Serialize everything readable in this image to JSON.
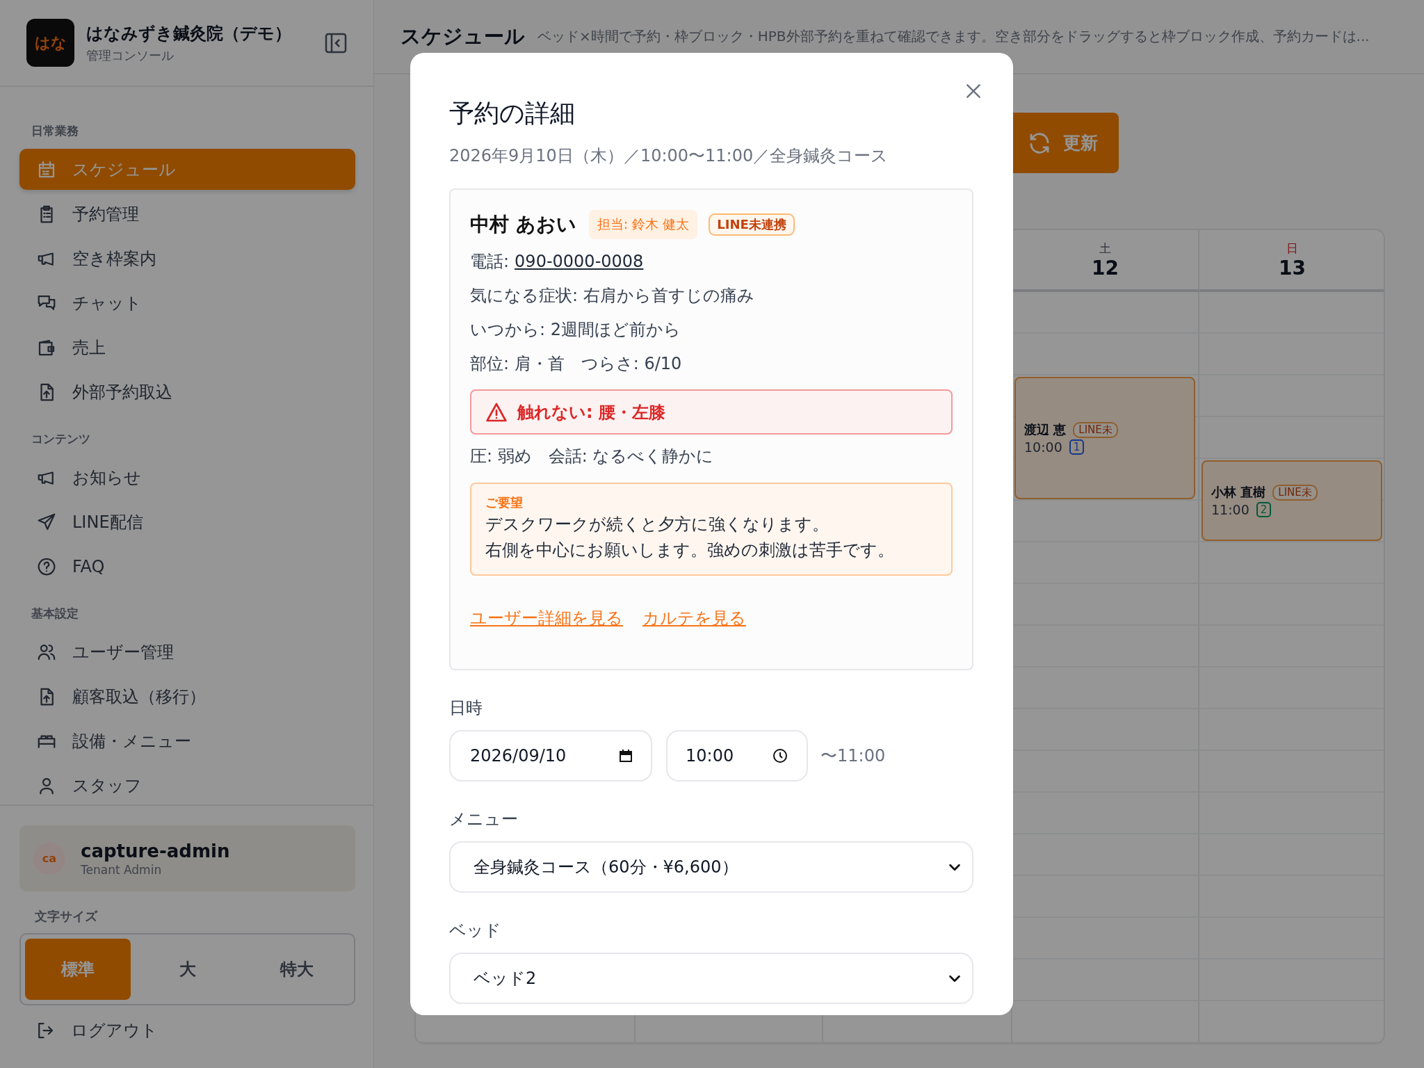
{
  "sidebar": {
    "logo": "はな",
    "title": "はなみずき鍼灸院（デモ）",
    "subtitle": "管理コンソール",
    "sections": [
      {
        "heading": "日常業務",
        "items": [
          {
            "label": "スケジュール",
            "selected": true
          },
          {
            "label": "予約管理",
            "selected": false
          },
          {
            "label": "空き枠案内",
            "selected": false
          },
          {
            "label": "チャット",
            "selected": false
          },
          {
            "label": "売上",
            "selected": false
          },
          {
            "label": "外部予約取込",
            "selected": false
          }
        ]
      },
      {
        "heading": "コンテンツ",
        "items": [
          {
            "label": "お知らせ",
            "selected": false
          },
          {
            "label": "LINE配信",
            "selected": false
          },
          {
            "label": "FAQ",
            "selected": false
          }
        ]
      },
      {
        "heading": "基本設定",
        "items": [
          {
            "label": "ユーザー管理",
            "selected": false
          },
          {
            "label": "顧客取込（移行）",
            "selected": false
          },
          {
            "label": "設備・メニュー",
            "selected": false
          },
          {
            "label": "スタッフ",
            "selected": false
          }
        ]
      }
    ],
    "user": {
      "initials": "ca",
      "name": "capture-admin",
      "role": "Tenant Admin"
    },
    "font_size": {
      "label": "文字サイズ",
      "options": [
        {
          "label": "標準",
          "selected": true
        },
        {
          "label": "大",
          "selected": false
        },
        {
          "label": "特大",
          "selected": false
        }
      ]
    },
    "logout": "ログアウト"
  },
  "header": {
    "title": "スケジュール",
    "description": "ベッド×時間で予約・枠ブロック・HPB外部予約を重ねて確認できます。空き部分をドラッグすると枠ブロック作成、予約カードは..."
  },
  "refresh_button": "更新",
  "calendar": {
    "days": [
      {
        "weekday": "土",
        "date": "12",
        "kind": "day"
      },
      {
        "weekday": "日",
        "date": "13",
        "kind": "sunday"
      }
    ],
    "appointments": [
      {
        "name": "渡辺 恵",
        "badge": "LINE未",
        "time": "10:00",
        "bed": "1",
        "color": "#163a8b"
      },
      {
        "name": "小林 直樹",
        "badge": "LINE未",
        "time": "11:00",
        "bed": "2",
        "color": "#03593e"
      }
    ]
  },
  "modal": {
    "title": "予約の詳細",
    "summary": "2026年9月10日（木）／10:00〜11:00／全身鍼灸コース",
    "customer": {
      "name": "中村 あおい",
      "staff_badge": "担当: 鈴木 健太",
      "line_badge": "LINE未連携",
      "phone_label": "電話:",
      "phone": "090-0000-0008",
      "details": [
        "気になる症状: 右肩から首すじの痛み",
        "いつから: 2週間ほど前から",
        "部位: 肩・首　つらさ: 6/10"
      ],
      "warning": "触れない: 腰・左膝",
      "preferences": "圧: 弱め　会話: なるべく静かに",
      "request": {
        "heading": "ご要望",
        "lines": [
          "デスクワークが続くと夕方に強くなります。",
          "右側を中心にお願いします。強めの刺激は苦手です。"
        ]
      },
      "links": [
        "ユーザー詳細を見る",
        "カルテを見る"
      ]
    },
    "datetime": {
      "label": "日時",
      "date": "2026/09/10",
      "time": "10:00",
      "end": "〜11:00"
    },
    "menu": {
      "label": "メニュー",
      "value": "全身鍼灸コース（60分・¥6,600）"
    },
    "bed": {
      "label": "ベッド",
      "value": "ベッド2"
    }
  }
}
